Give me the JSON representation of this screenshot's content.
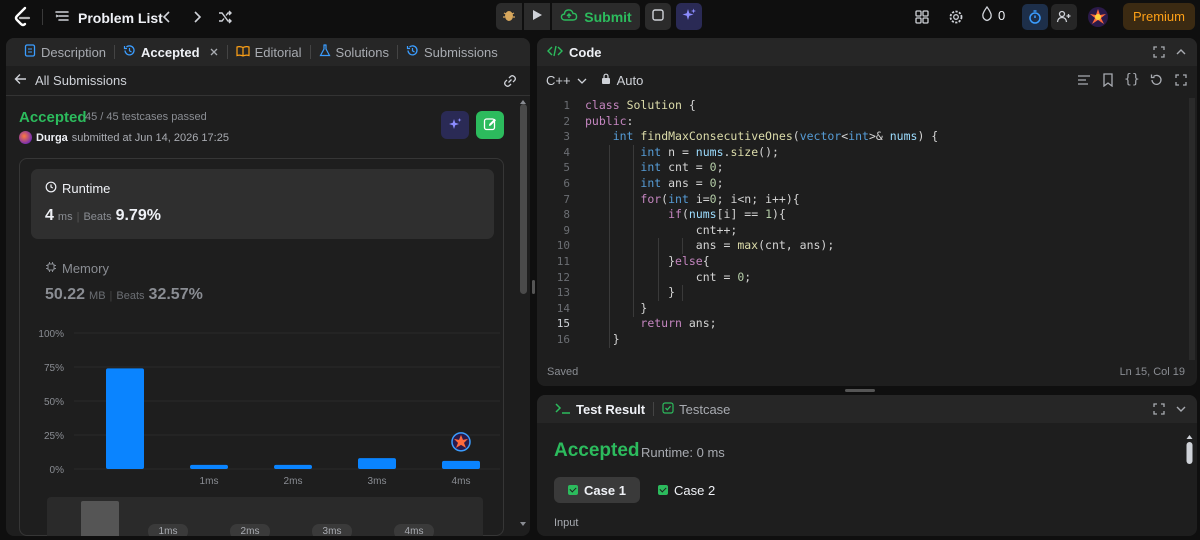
{
  "topbar": {
    "problem_list": "Problem List",
    "submit_label": "Submit",
    "streak_count": "0",
    "premium_label": "Premium",
    "icons": [
      "leetcode-logo",
      "list-icon",
      "chevron-left-icon",
      "chevron-right-icon",
      "shuffle-icon",
      "debug-icon",
      "play-icon",
      "cloud-upload-icon",
      "note-icon",
      "sparkle-icon",
      "grid-icon",
      "gear-icon",
      "fire-icon",
      "timer-icon",
      "add-user-icon",
      "avatar"
    ]
  },
  "left": {
    "tabs": [
      {
        "label": "Description",
        "icon": "document-icon"
      },
      {
        "label": "Accepted",
        "icon": "history-icon",
        "active": true
      },
      {
        "label": "Editorial",
        "icon": "book-icon"
      },
      {
        "label": "Solutions",
        "icon": "flask-icon"
      },
      {
        "label": "Submissions",
        "icon": "history-icon"
      }
    ],
    "back_label": "All Submissions",
    "status": "Accepted",
    "testcases": "45 / 45 testcases passed",
    "submitter": "Durga",
    "submitted_text": "submitted at Jun 14, 2026 17:25",
    "runtime": {
      "label": "Runtime",
      "value": "4",
      "unit": "ms",
      "beats_label": "Beats",
      "beats": "9.79%"
    },
    "memory": {
      "label": "Memory",
      "value": "50.22",
      "unit": "MB",
      "beats_label": "Beats",
      "beats": "32.57%"
    }
  },
  "chart_data": {
    "type": "bar",
    "categories": [
      "",
      "1ms",
      "2ms",
      "3ms",
      "4ms"
    ],
    "values": [
      74,
      3,
      3,
      8,
      6
    ],
    "yticks": [
      "100%",
      "75%",
      "50%",
      "25%",
      "0%"
    ],
    "ylim": [
      0,
      100
    ],
    "highlight_category": "4ms",
    "overview_labels": [
      "1ms",
      "2ms",
      "3ms",
      "4ms"
    ],
    "colors": {
      "bar": "#0a84ff"
    }
  },
  "code": {
    "header": "Code",
    "language": "C++",
    "mode": "Auto",
    "lines": [
      "class Solution {",
      "public:",
      "    int findMaxConsecutiveOnes(vector<int>& nums) {",
      "        int n = nums.size();",
      "        int cnt = 0;",
      "        int ans = 0;",
      "        for(int i=0; i<n; i++){",
      "            if(nums[i] == 1){",
      "                cnt++;",
      "                ans = max(cnt, ans);",
      "            }else{",
      "                cnt = 0;",
      "            }",
      "        }",
      "        return ans;",
      "    }"
    ],
    "line_numbers": [
      "1",
      "2",
      "3",
      "4",
      "5",
      "6",
      "7",
      "8",
      "9",
      "10",
      "11",
      "12",
      "13",
      "14",
      "15",
      "16"
    ],
    "saved": "Saved",
    "cursor": "Ln 15, Col 19"
  },
  "result": {
    "tabs": [
      {
        "label": "Test Result",
        "active": true
      },
      {
        "label": "Testcase"
      }
    ],
    "status": "Accepted",
    "runtime": "Runtime: 0 ms",
    "cases": [
      "Case 1",
      "Case 2"
    ],
    "input_label": "Input"
  }
}
